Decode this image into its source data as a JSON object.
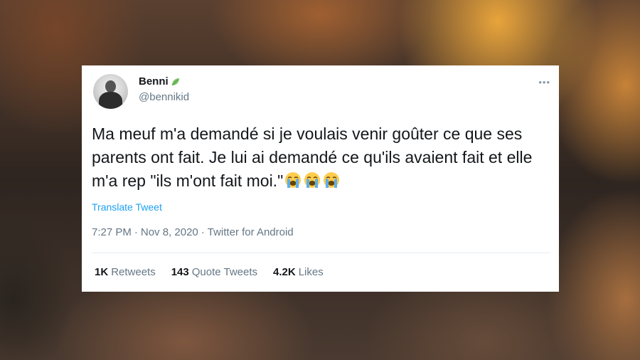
{
  "tweet": {
    "name": "Benni",
    "handle": "@bennikid",
    "text": "Ma meuf m'a demandé si je voulais venir goûter ce que ses parents ont fait. Je lui ai demandé ce qu'ils avaient fait et elle m'a rep \"ils m'ont fait moi.\"",
    "emoji_name": "loudly-crying-face-emoji",
    "emoji_count": 3,
    "translate_label": "Translate Tweet",
    "time": "7:27 PM",
    "date": "Nov 8, 2020",
    "source": "Twitter for Android",
    "separator": "·",
    "more_icon": "•••",
    "verified_badge_icon": "leaf-icon"
  },
  "stats": {
    "retweets_count": "1K",
    "retweets_label": "Retweets",
    "quotes_count": "143",
    "quotes_label": "Quote Tweets",
    "likes_count": "4.2K",
    "likes_label": "Likes"
  },
  "colors": {
    "accent": "#1da1f2",
    "text_primary": "#14171a",
    "text_secondary": "#657786",
    "divider": "#e6ecf0",
    "leaf": "#7cc36a"
  }
}
